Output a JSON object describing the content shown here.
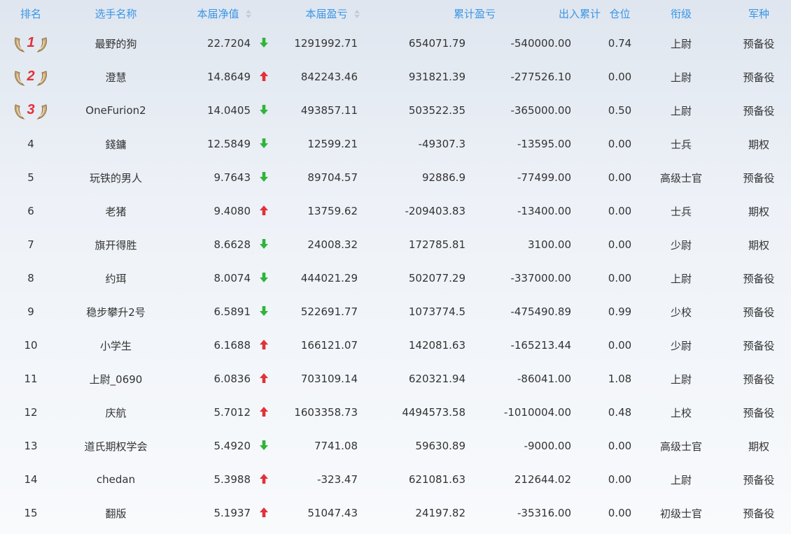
{
  "headers": {
    "rank": "排名",
    "player": "选手名称",
    "nav": "本届净值",
    "pnl": "本届盈亏",
    "cum_pnl": "累计盈亏",
    "flow": "出入累计",
    "position": "仓位",
    "level": "衔级",
    "branch": "军种"
  },
  "colors": {
    "header_text": "#3a95e6",
    "up": "#e0323a",
    "down": "#2fb43a",
    "badge_number": "#e0323a",
    "wing": "#b89a6a"
  },
  "rows": [
    {
      "rank": "1",
      "name": "最野的狗",
      "nav": "22.7204",
      "dir": "down",
      "pnl": "1291992.71",
      "cum": "654071.79",
      "flow": "-540000.00",
      "pos": "0.74",
      "level": "上尉",
      "branch": "预备役"
    },
    {
      "rank": "2",
      "name": "澄慧",
      "nav": "14.8649",
      "dir": "up",
      "pnl": "842243.46",
      "cum": "931821.39",
      "flow": "-277526.10",
      "pos": "0.00",
      "level": "上尉",
      "branch": "预备役"
    },
    {
      "rank": "3",
      "name": "OneFurion2",
      "nav": "14.0405",
      "dir": "down",
      "pnl": "493857.11",
      "cum": "503522.35",
      "flow": "-365000.00",
      "pos": "0.50",
      "level": "上尉",
      "branch": "预备役"
    },
    {
      "rank": "4",
      "name": "錢鏞",
      "nav": "12.5849",
      "dir": "down",
      "pnl": "12599.21",
      "cum": "-49307.3",
      "flow": "-13595.00",
      "pos": "0.00",
      "level": "士兵",
      "branch": "期权"
    },
    {
      "rank": "5",
      "name": "玩铁的男人",
      "nav": "9.7643",
      "dir": "down",
      "pnl": "89704.57",
      "cum": "92886.9",
      "flow": "-77499.00",
      "pos": "0.00",
      "level": "高级士官",
      "branch": "预备役"
    },
    {
      "rank": "6",
      "name": "老猪",
      "nav": "9.4080",
      "dir": "up",
      "pnl": "13759.62",
      "cum": "-209403.83",
      "flow": "-13400.00",
      "pos": "0.00",
      "level": "士兵",
      "branch": "期权"
    },
    {
      "rank": "7",
      "name": "旗开得胜",
      "nav": "8.6628",
      "dir": "down",
      "pnl": "24008.32",
      "cum": "172785.81",
      "flow": "3100.00",
      "pos": "0.00",
      "level": "少尉",
      "branch": "期权"
    },
    {
      "rank": "8",
      "name": "约珥",
      "nav": "8.0074",
      "dir": "down",
      "pnl": "444021.29",
      "cum": "502077.29",
      "flow": "-337000.00",
      "pos": "0.00",
      "level": "上尉",
      "branch": "预备役"
    },
    {
      "rank": "9",
      "name": "稳步攀升2号",
      "nav": "6.5891",
      "dir": "down",
      "pnl": "522691.77",
      "cum": "1073774.5",
      "flow": "-475490.89",
      "pos": "0.99",
      "level": "少校",
      "branch": "预备役"
    },
    {
      "rank": "10",
      "name": "小学生",
      "nav": "6.1688",
      "dir": "up",
      "pnl": "166121.07",
      "cum": "142081.63",
      "flow": "-165213.44",
      "pos": "0.00",
      "level": "少尉",
      "branch": "预备役"
    },
    {
      "rank": "11",
      "name": "上尉_0690",
      "nav": "6.0836",
      "dir": "up",
      "pnl": "703109.14",
      "cum": "620321.94",
      "flow": "-86041.00",
      "pos": "1.08",
      "level": "上尉",
      "branch": "预备役"
    },
    {
      "rank": "12",
      "name": "庆航",
      "nav": "5.7012",
      "dir": "up",
      "pnl": "1603358.73",
      "cum": "4494573.58",
      "flow": "-1010004.00",
      "pos": "0.48",
      "level": "上校",
      "branch": "预备役"
    },
    {
      "rank": "13",
      "name": "道氏期权学会",
      "nav": "5.4920",
      "dir": "down",
      "pnl": "7741.08",
      "cum": "59630.89",
      "flow": "-9000.00",
      "pos": "0.00",
      "level": "高级士官",
      "branch": "期权"
    },
    {
      "rank": "14",
      "name": "chedan",
      "nav": "5.3988",
      "dir": "up",
      "pnl": "-323.47",
      "cum": "621081.63",
      "flow": "212644.02",
      "pos": "0.00",
      "level": "上尉",
      "branch": "预备役"
    },
    {
      "rank": "15",
      "name": "翻版",
      "nav": "5.1937",
      "dir": "up",
      "pnl": "51047.43",
      "cum": "24197.82",
      "flow": "-35316.00",
      "pos": "0.00",
      "level": "初级士官",
      "branch": "预备役"
    }
  ]
}
